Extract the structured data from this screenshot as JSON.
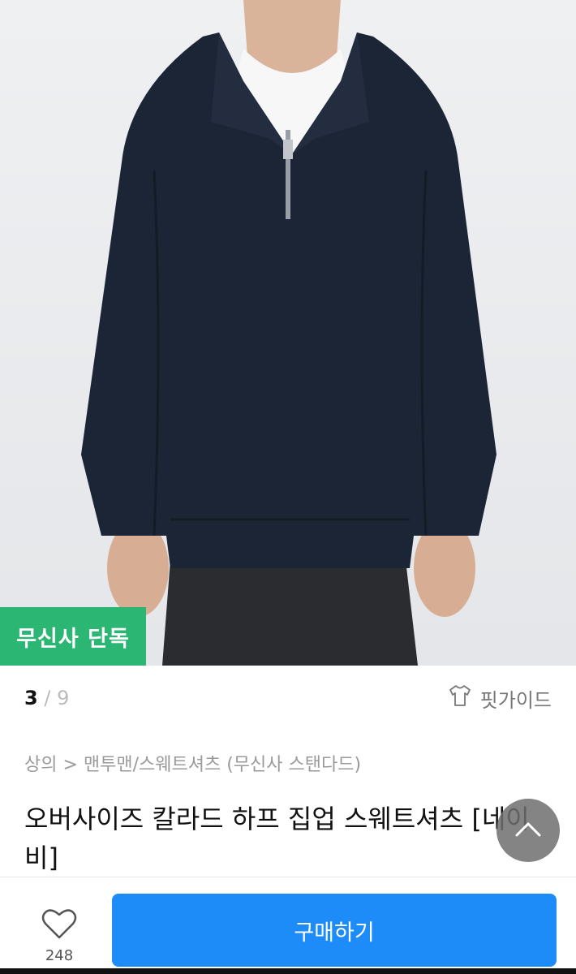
{
  "gallery": {
    "badge": "무신사 단독",
    "current": "3",
    "separator": "/",
    "total": "9"
  },
  "fit_guide": {
    "label": "핏가이드"
  },
  "breadcrumb": {
    "text": "상의 > 맨투맨/스웨트셔츠 (무신사 스탠다드)"
  },
  "product": {
    "title": "오버사이즈 칼라드 하프 집업 스웨트셔츠 [네이비]"
  },
  "actions": {
    "like_count": "248",
    "buy_label": "구매하기"
  },
  "colors": {
    "badge": "#2bb673",
    "buy_button": "#1d8cf8",
    "sweatshirt": "#1c2535"
  }
}
